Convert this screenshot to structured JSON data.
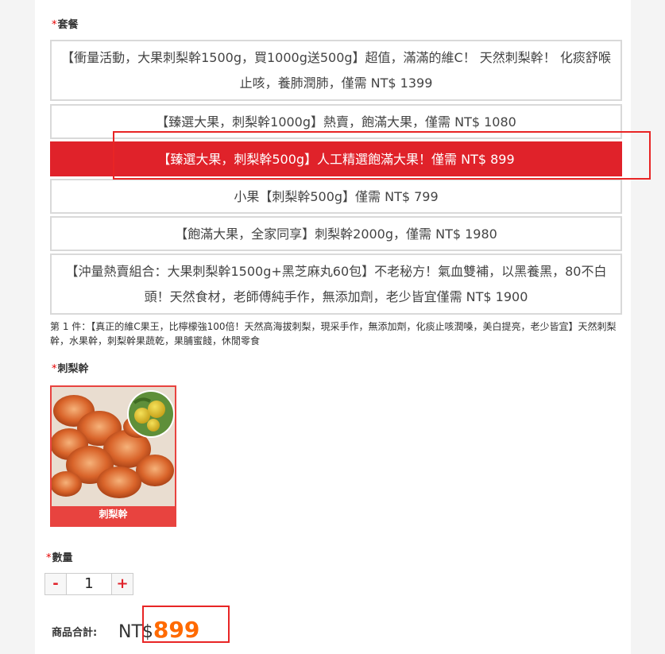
{
  "package_section": {
    "required_mark": "*",
    "label": "套餐",
    "options": [
      {
        "label": "【衝量活動，大果刺梨幹1500g，買1000g送500g】超值，滿滿的維C！ 天然刺梨幹！ 化痰舒喉止咳，養肺潤肺，僅需 NT$ 1399",
        "selected": false
      },
      {
        "label": "【臻選大果，刺梨幹1000g】熱賣，飽滿大果，僅需 NT$ 1080",
        "selected": false
      },
      {
        "label": "【臻選大果，刺梨幹500g】人工精選飽滿大果！僅需 NT$ 899",
        "selected": true
      },
      {
        "label": "小果【刺梨幹500g】僅需 NT$ 799",
        "selected": false
      },
      {
        "label": "【飽滿大果，全家同享】刺梨幹2000g，僅需 NT$ 1980",
        "selected": false
      },
      {
        "label": "【沖量熱賣組合：大果刺梨幹1500g+黑芝麻丸60包】不老秘方！氣血雙補，以黑養黑，80不白頭！天然食材，老師傅純手作，無添加劑，老少皆宜僅需 NT$ 1900",
        "selected": false
      }
    ],
    "description": "第 1 件：【真正的維C果王，比檸檬強100倍！天然高海拔刺梨，現采手作，無添加劑，化痰止咳潤嗓，美白提亮，老少皆宜】天然刺梨幹，水果幹，刺梨幹果蔬乾，果脯蜜餞，休閒零食"
  },
  "variant_section": {
    "required_mark": "*",
    "label": "刺梨幹",
    "variants": [
      {
        "caption": "刺梨幹",
        "selected": true
      }
    ]
  },
  "quantity_section": {
    "required_mark": "*",
    "label": "數量",
    "minus": "-",
    "value": "1",
    "plus": "+"
  },
  "total": {
    "label": "商品合計:",
    "currency": "NT$",
    "amount": "899"
  },
  "colors": {
    "accent_red": "#e0222a",
    "price_orange": "#ff6a00",
    "annotation_red": "#e82525"
  }
}
